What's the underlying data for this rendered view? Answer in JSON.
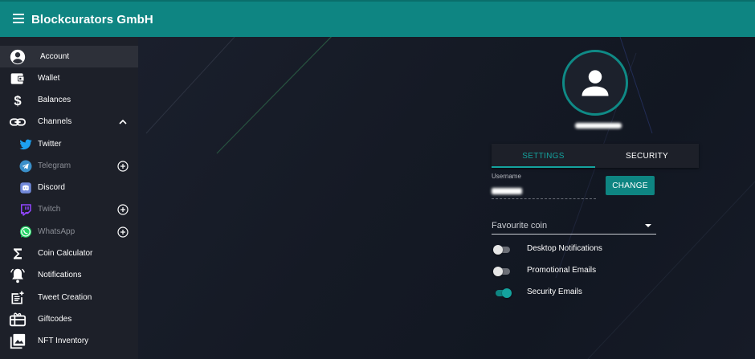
{
  "app": {
    "title": "Blockcurators GmbH"
  },
  "sidebar": {
    "items": [
      {
        "label": "Account",
        "icon": "account-circle-icon",
        "active": true
      },
      {
        "label": "Wallet",
        "icon": "wallet-icon"
      },
      {
        "label": "Balances",
        "icon": "dollar-icon"
      },
      {
        "label": "Channels",
        "icon": "link-icon",
        "expanded": true
      },
      {
        "label": "Twitter",
        "icon": "twitter-icon"
      },
      {
        "label": "Telegram",
        "icon": "telegram-icon",
        "disabled": true
      },
      {
        "label": "Discord",
        "icon": "discord-icon"
      },
      {
        "label": "Twitch",
        "icon": "twitch-icon",
        "disabled": true
      },
      {
        "label": "WhatsApp",
        "icon": "whatsapp-icon",
        "disabled": true
      },
      {
        "label": "Coin Calculator",
        "icon": "sigma-icon"
      },
      {
        "label": "Notifications",
        "icon": "bell-icon"
      },
      {
        "label": "Tweet Creation",
        "icon": "post-add-icon"
      },
      {
        "label": "Giftcodes",
        "icon": "gift-card-icon"
      },
      {
        "label": "NFT Inventory",
        "icon": "image-collection-icon"
      }
    ]
  },
  "profile": {
    "tabs": [
      "SETTINGS",
      "SECURITY"
    ],
    "active_tab": "SETTINGS",
    "username_label": "Username",
    "change_button": "CHANGE",
    "favourite_coin": {
      "placeholder": "Favourite coin"
    },
    "toggles": [
      {
        "label": "Desktop Notifications",
        "on": false
      },
      {
        "label": "Promotional Emails",
        "on": false
      },
      {
        "label": "Security Emails",
        "on": true
      }
    ]
  },
  "colors": {
    "primary": "#0e8582",
    "accent": "#14a39e",
    "sidebar_bg": "#1d2029",
    "main_bg": "#161b26"
  }
}
